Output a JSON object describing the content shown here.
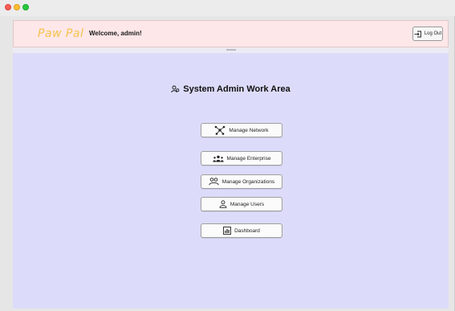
{
  "header": {
    "logo_text": "Paw Pal",
    "welcome_text": "Welcome, admin!",
    "logout_label": "Log Out"
  },
  "main": {
    "title": "System Admin Work Area",
    "buttons": [
      {
        "label": "Manage Network",
        "icon": "network-icon"
      },
      {
        "label": "Manage Enterprise",
        "icon": "group-icon"
      },
      {
        "label": "Manage Organizations",
        "icon": "organizations-icon"
      },
      {
        "label": "Manage Users",
        "icon": "user-icon"
      },
      {
        "label": "Dashboard",
        "icon": "chart-icon"
      }
    ]
  },
  "colors": {
    "logo": "#f5c34a",
    "header_bg": "#fde7e8",
    "main_bg": "#dcdcfa"
  }
}
